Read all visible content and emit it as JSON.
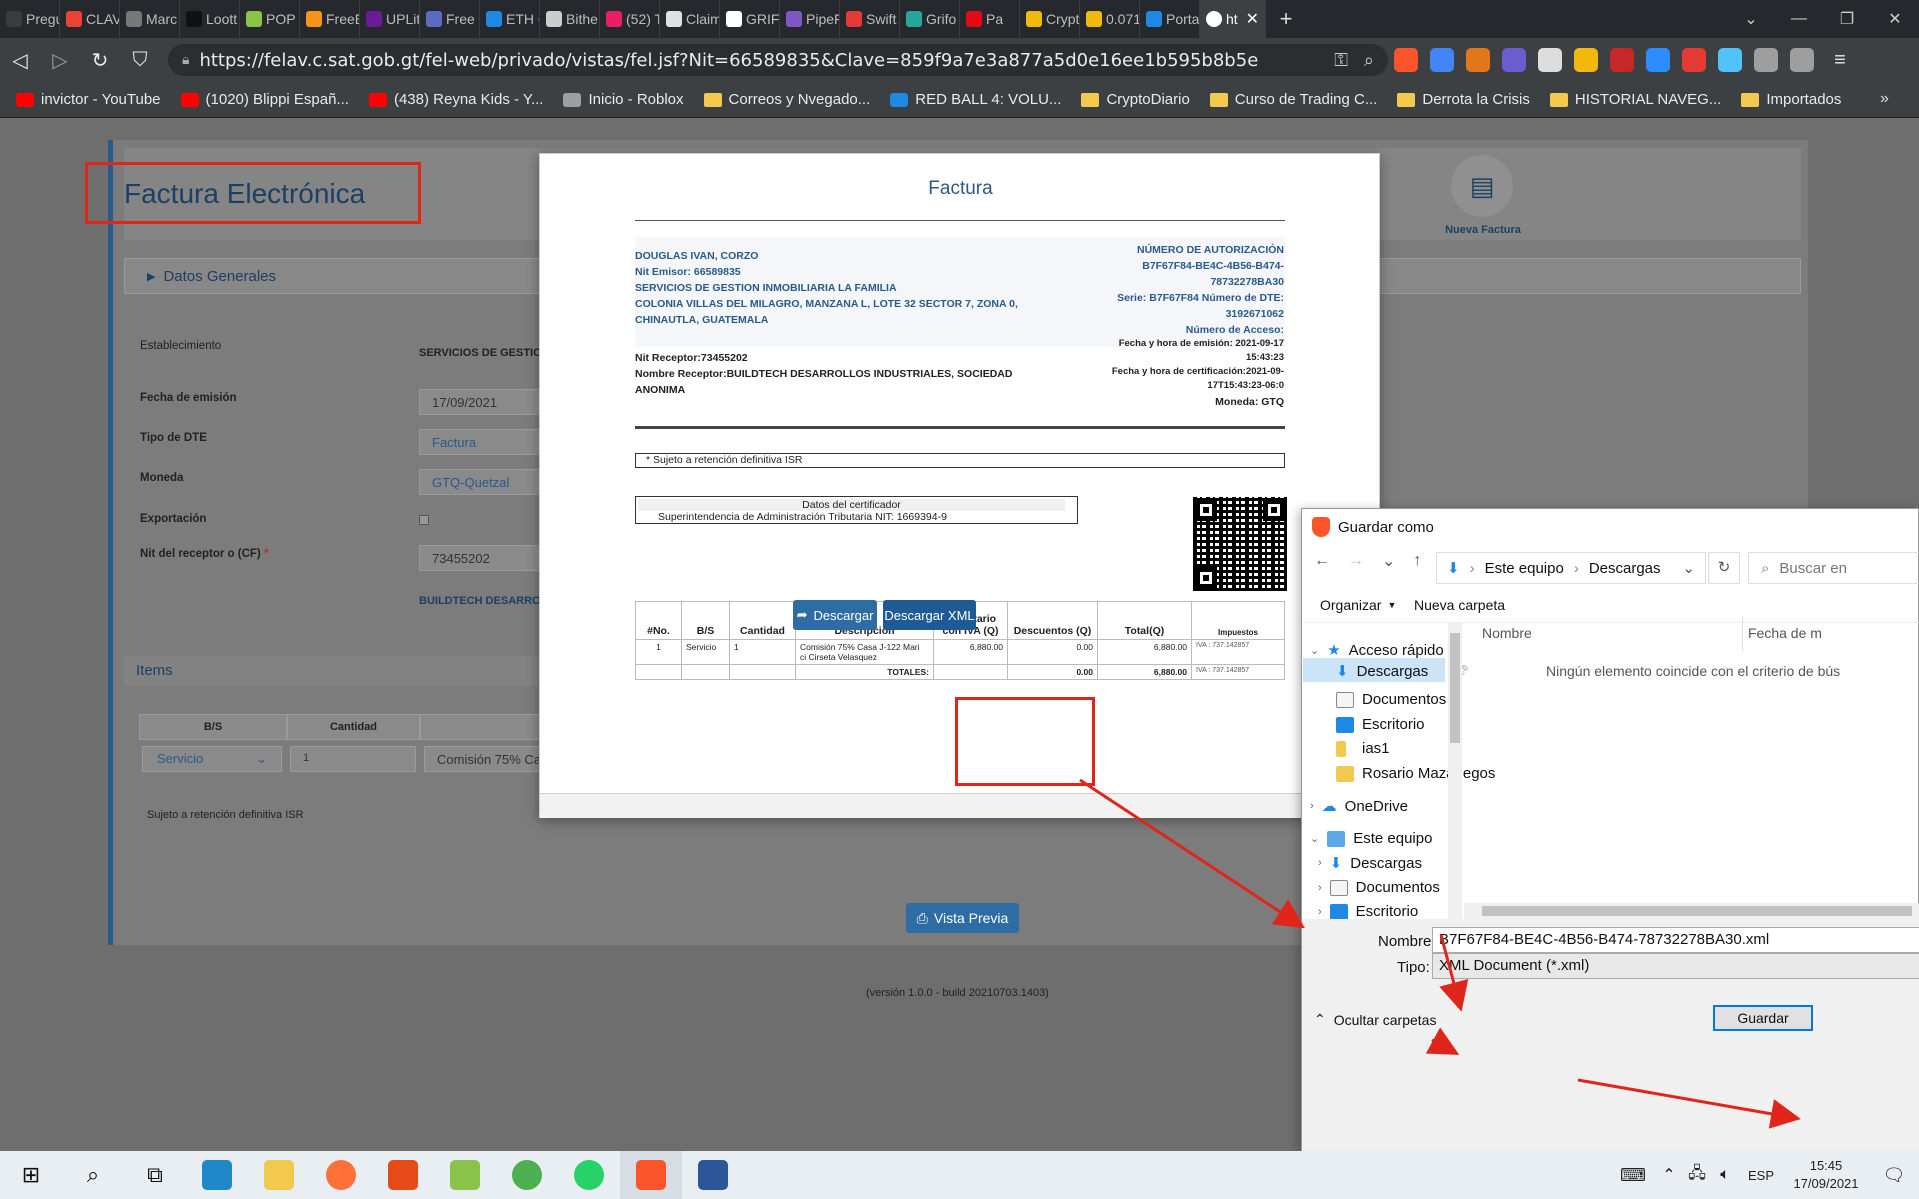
{
  "browser": {
    "tabs": [
      {
        "label": "Pregu",
        "color": "#3c3c3c"
      },
      {
        "label": "CLAV",
        "color": "#ea4335"
      },
      {
        "label": "Marc",
        "color": "#777"
      },
      {
        "label": "Loott",
        "color": "#111"
      },
      {
        "label": "POP",
        "color": "#8bc34a"
      },
      {
        "label": "FreeE",
        "color": "#f7931a"
      },
      {
        "label": "UPLit",
        "color": "#6a1b9a"
      },
      {
        "label": "Free",
        "color": "#5c6bc0"
      },
      {
        "label": "ETH C",
        "color": "#1e88e5"
      },
      {
        "label": "Bithe",
        "color": "#ccc"
      },
      {
        "label": "(52) T",
        "color": "#e91e63"
      },
      {
        "label": "Claim",
        "color": "#e0e0e0"
      },
      {
        "label": "GRIFC",
        "color": "#fff"
      },
      {
        "label": "PipeF",
        "color": "#7e57c2"
      },
      {
        "label": "Swift",
        "color": "#e53935"
      },
      {
        "label": "Grifo",
        "color": "#26a69a"
      },
      {
        "label": "Pa",
        "color": "#e50914"
      },
      {
        "label": "Crypt",
        "color": "#f0b90b"
      },
      {
        "label": "0.071",
        "color": "#f0b90b"
      },
      {
        "label": "Porta",
        "color": "#1e88e5"
      }
    ],
    "active_tab": "ht",
    "url": "https://felav.c.sat.gob.gt/fel-web/privado/vistas/fel.jsf?Nit=66589835&Clave=859f9a7e3a877a5d0e16ee1b595b8b5e",
    "bookmarks": [
      {
        "label": "invictor - YouTube",
        "type": "yt"
      },
      {
        "label": "(1020) Blippi Españ...",
        "type": "yt"
      },
      {
        "label": "(438) Reyna Kids - Y...",
        "type": "yt"
      },
      {
        "label": "Inicio - Roblox",
        "type": "roblox"
      },
      {
        "label": "Correos y Nvegado...",
        "type": "folder"
      },
      {
        "label": "RED BALL 4: VOLU...",
        "type": "ball"
      },
      {
        "label": "CryptoDiario",
        "type": "folder"
      },
      {
        "label": "Curso de Trading C...",
        "type": "folder"
      },
      {
        "label": "Derrota la Crisis",
        "type": "folder"
      },
      {
        "label": "HISTORIAL NAVEG...",
        "type": "folder"
      },
      {
        "label": "Importados",
        "type": "folder"
      }
    ]
  },
  "page": {
    "title": "Factura Electrónica",
    "new_invoice_label": "Nueva Factura",
    "general_section": "Datos Generales",
    "fields": {
      "establecimiento_label": "Establecimiento",
      "establecimiento_value": "SERVICIOS DE GESTIC",
      "fecha_label": "Fecha de emisión",
      "fecha_value": "17/09/2021",
      "tipo_label": "Tipo de DTE",
      "tipo_value": "Factura",
      "moneda_label": "Moneda",
      "moneda_value": "GTQ-Quetzal",
      "exportacion_label": "Exportación",
      "nit_label": "Nit del receptor o (CF)",
      "nit_value": "73455202",
      "receptor_name": "BUILDTECH DESARRC"
    },
    "items_section": "Items",
    "items_headers": {
      "bs": "B/S",
      "cantidad": "Cantidad"
    },
    "items_row": {
      "bs": "Servicio",
      "cantidad": "1",
      "desc": "Comisión  75% Ca"
    },
    "isr_note": "Sujeto a retención definitiva ISR",
    "preview_button": "Vista Previa",
    "version": "(versión 1.0.0 - build 20210703.1403)"
  },
  "invoice": {
    "title": "Factura",
    "emitter": {
      "name": "DOUGLAS IVAN, CORZO",
      "nit": "Nit Emisor: 66589835",
      "business": "SERVICIOS DE GESTION INMOBILIARIA LA FAMILIA",
      "address1": "COLONIA VILLAS DEL MILAGRO, MANZANA L, LOTE 32 SECTOR 7, ZONA 0,",
      "address2": "CHINAUTLA, GUATEMALA"
    },
    "auth": {
      "label": "NÚMERO DE AUTORIZACIÓN",
      "line1": "B7F67F84-BE4C-4B56-B474-",
      "line2": "78732278BA30",
      "serie": "Serie: B7F67F84 Número de DTE:",
      "dte": "3192671062",
      "acceso": "Número de Acceso:",
      "emision": "Fecha y hora de emisión: 2021-09-17",
      "emision2": "15:43:23",
      "cert": "Fecha y hora de certificación:2021-09-",
      "cert2": "17T15:43:23-06:0",
      "moneda": "Moneda: GTQ"
    },
    "receptor": {
      "nit": "Nit Receptor:73455202",
      "name1": "Nombre Receptor:BUILDTECH DESARROLLOS INDUSTRIALES, SOCIEDAD",
      "name2": "ANONIMA"
    },
    "table_headers": {
      "no": "#No.",
      "bs": "B/S",
      "cantidad": "Cantidad",
      "desc": "Descripcion",
      "punit1": "P. Unitario",
      "punit2": "con IVA (Q)",
      "desc_q": "Descuentos (Q)",
      "total": "Total(Q)",
      "imp": "Impuestos"
    },
    "row": {
      "no": "1",
      "bs": "Servicio",
      "cantidad": "1",
      "desc1": "Comisión 75% Casa J-122 Mari",
      "desc2": "ci Cirseta Velasquez",
      "punit": "6,880.00",
      "desc_q": "0.00",
      "total": "6,880.00",
      "imp": "IVA : 737.142857"
    },
    "totals": {
      "label": "TOTALES:",
      "desc_q": "0.00",
      "total": "6,880.00",
      "imp": "IVA : 737.142857"
    },
    "isr": "* Sujeto a retención definitiva ISR",
    "cert_title": "Datos del certificador",
    "cert_body": "Superintendencia de Administración Tributaria NIT: 1669394-9",
    "btn_descargar": "Descargar",
    "btn_xml": "Descargar XML"
  },
  "save_dialog": {
    "title": "Guardar como",
    "breadcrumb": [
      "Este equipo",
      "Descargas"
    ],
    "search_placeholder": "Buscar en",
    "organize": "Organizar",
    "new_folder": "Nueva carpeta",
    "col_name": "Nombre",
    "col_date": "Fecha de m",
    "empty": "Ningún elemento coincide con el criterio de bús",
    "tree": {
      "quick": "Acceso rápido",
      "descargas": "Descargas",
      "documentos": "Documentos",
      "escritorio": "Escritorio",
      "ias1": "ias1",
      "rosario": "Rosario Mazariеgos",
      "onedrive": "OneDrive",
      "pc": "Este equipo",
      "pc_descargas": "Descargas",
      "pc_documentos": "Documentos",
      "pc_escritorio": "Escritorio"
    },
    "name_label": "Nombre:",
    "name_value": "B7F67F84-BE4C-4B56-B474-78732278BA30.xml",
    "type_label": "Tipo:",
    "type_value": "XML Document (*.xml)",
    "hide_folders": "Ocultar carpetas",
    "save_button": "Guardar"
  },
  "taskbar": {
    "lang": "ESP",
    "time": "15:45",
    "date": "17/09/2021"
  },
  "colors": {
    "accent": "#2e6da4",
    "annotation_red": "#e0261b"
  }
}
